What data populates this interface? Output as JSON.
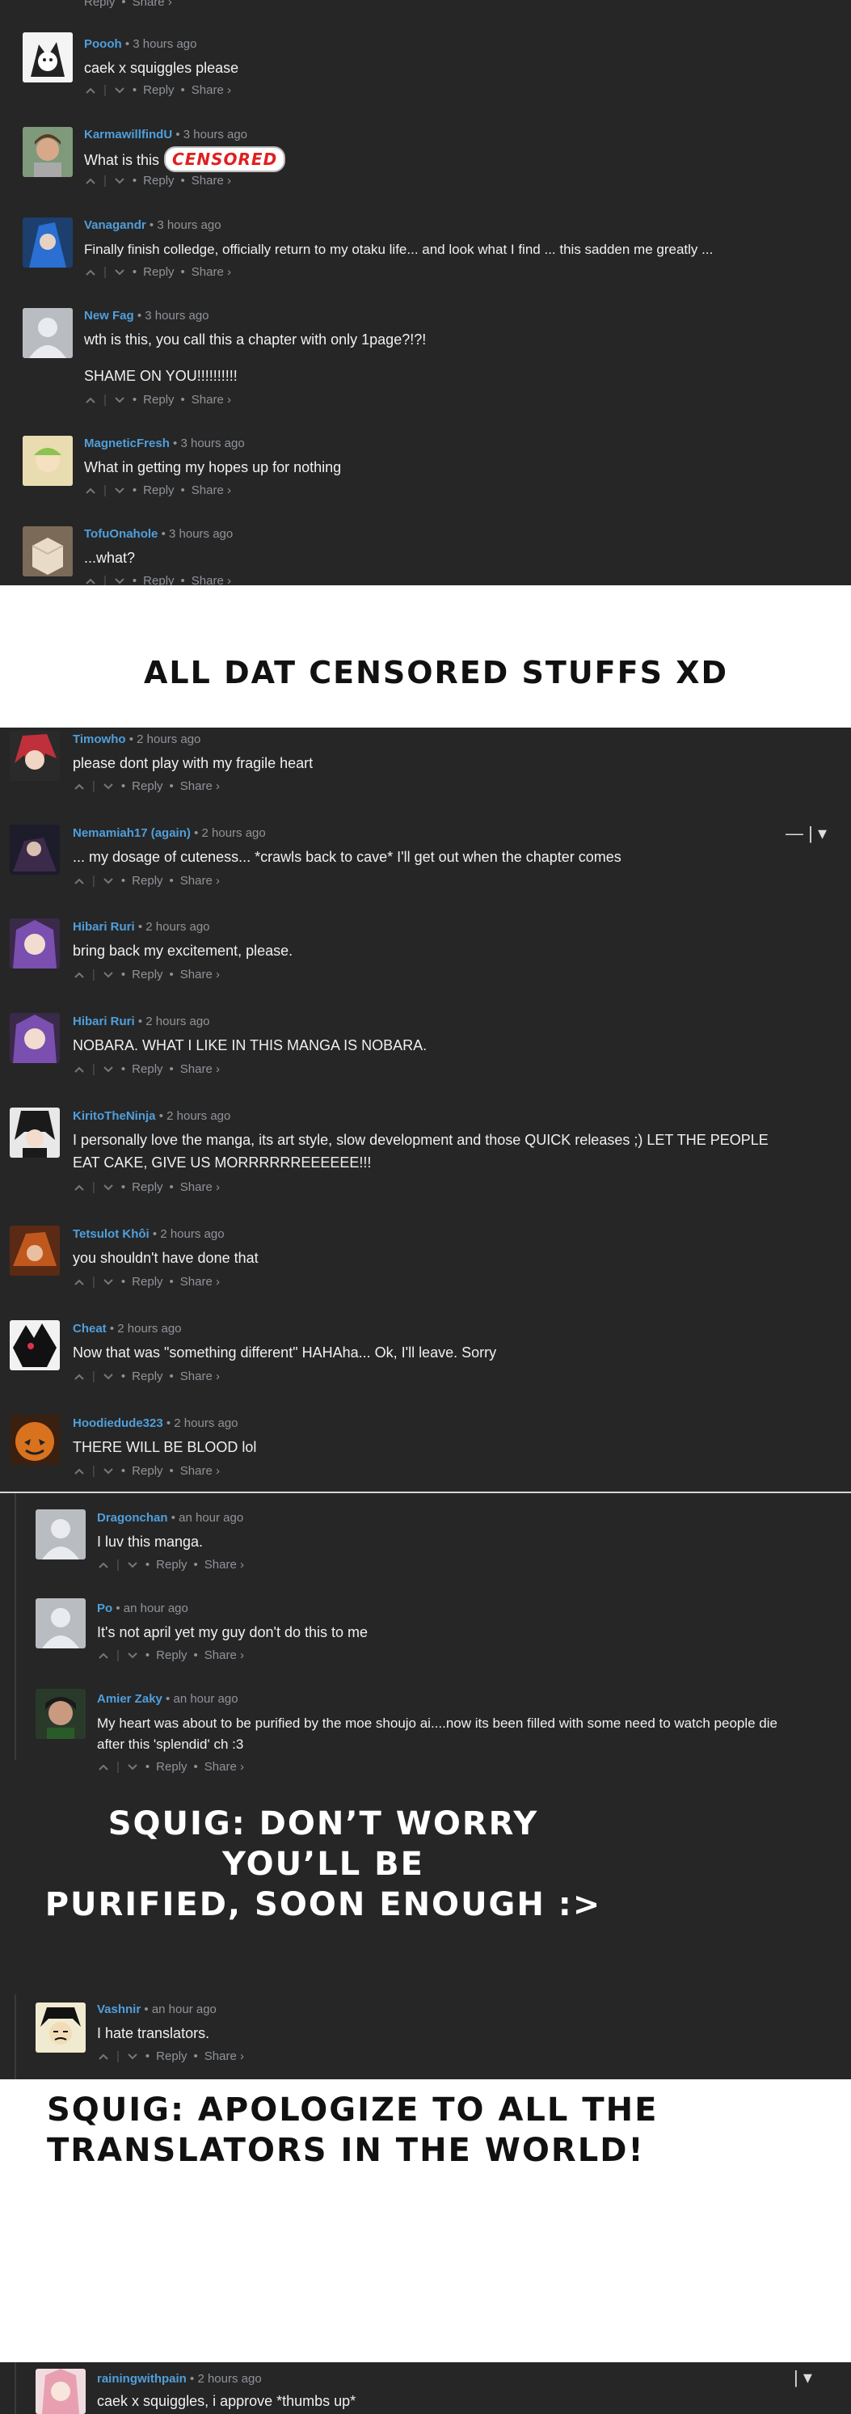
{
  "actions": {
    "reply": "Reply",
    "share": "Share ›"
  },
  "captions": {
    "c1": "ALL DAT CENSORED STUFFS XD",
    "c2_line1": "SQUIG: DON’T WORRY YOU’LL BE",
    "c2_line2": "PURIFIED, SOON ENOUGH :>",
    "c3_line1": "SQUIG: APOLOGIZE TO ALL THE",
    "c3_line2": "TRANSLATORS IN THE WORLD!"
  },
  "censored_label": "CENSORED",
  "comments": [
    {
      "user": "Poooh",
      "time": "3 hours ago",
      "text": "caek x squiggles please"
    },
    {
      "user": "KarmawillfindU",
      "time": "3 hours ago",
      "text": "What is this"
    },
    {
      "user": "Vanagandr",
      "time": "3 hours ago",
      "text": "Finally finish colledge, officially return to my otaku life... and look what I find ... this sadden me greatly ..."
    },
    {
      "user": "New Fag",
      "time": "3 hours ago",
      "text": "wth is this, you call this a chapter with only 1page?!?!",
      "text2": "SHAME ON YOU!!!!!!!!!!"
    },
    {
      "user": "MagneticFresh",
      "time": "3 hours ago",
      "text": "What in getting my hopes up for nothing"
    },
    {
      "user": "TofuOnahole",
      "time": "3 hours ago",
      "text": "...what?"
    },
    {
      "user": "Timowho",
      "time": "2 hours ago",
      "text": "please dont play with my fragile heart"
    },
    {
      "user": "Nemamiah17 (again)",
      "time": "2 hours ago",
      "text": "... my dosage of cuteness... *crawls back to cave* I'll get out when the chapter comes"
    },
    {
      "user": "Hibari Ruri",
      "time": "2 hours ago",
      "text": "bring back my excitement, please."
    },
    {
      "user": "Hibari Ruri",
      "time": "2 hours ago",
      "text": "NOBARA. WHAT I LIKE IN THIS MANGA IS NOBARA."
    },
    {
      "user": "KiritoTheNinja",
      "time": "2 hours ago",
      "text": "I personally love the manga, its art style, slow development and those QUICK releases ;) LET THE PEOPLE",
      "text2": "EAT CAKE, GIVE US MORRRRRREEEEEE!!!"
    },
    {
      "user": "Tetsulot Khôi",
      "time": "2 hours ago",
      "text": "you shouldn't have done that"
    },
    {
      "user": "Cheat",
      "time": "2 hours ago",
      "text": "Now that was \"something different\" HAHAha... Ok, I'll leave. Sorry"
    },
    {
      "user": "Hoodiedude323",
      "time": "2 hours ago",
      "text": "THERE WILL BE BLOOD lol"
    },
    {
      "user": "Dragonchan",
      "time": "an hour ago",
      "text": "I luv this manga."
    },
    {
      "user": "Po",
      "time": "an hour ago",
      "text": "It's not april yet my guy don't do this to me"
    },
    {
      "user": "Amier Zaky",
      "time": "an hour ago",
      "text": "My heart was about to be purified by the moe shoujo ai....now its been filled with some need to watch people die",
      "text2": "after this 'splendid' ch :3"
    },
    {
      "user": "Vashnir",
      "time": "an hour ago",
      "text": "I hate translators."
    },
    {
      "user": "rainingwithpain",
      "time": "2 hours ago",
      "text": "caek x squiggles, i approve *thumbs up*"
    }
  ],
  "colors": {
    "username": "#4f9fdc",
    "background": "#262626",
    "censored": "#e02020"
  }
}
